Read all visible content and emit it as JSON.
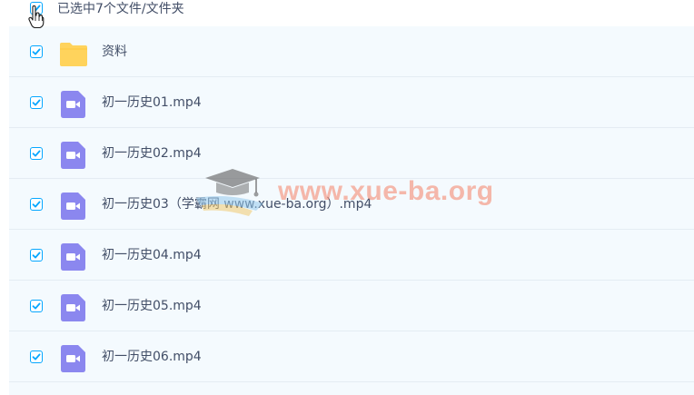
{
  "selection": {
    "summary": "已选中7个文件/文件夹",
    "all_checked": true
  },
  "rows": [
    {
      "name": "资料",
      "type": "folder",
      "checked": true
    },
    {
      "name": "初一历史01.mp4",
      "type": "video",
      "checked": true
    },
    {
      "name": "初一历史02.mp4",
      "type": "video",
      "checked": true
    },
    {
      "name": "初一历史03（学霸网 www.xue-ba.org）.mp4",
      "type": "video",
      "checked": true
    },
    {
      "name": "初一历史04.mp4",
      "type": "video",
      "checked": true
    },
    {
      "name": "初一历史05.mp4",
      "type": "video",
      "checked": true
    },
    {
      "name": "初一历史06.mp4",
      "type": "video",
      "checked": true
    }
  ],
  "watermark": {
    "text": "www.xue-ba.org"
  },
  "icons": {
    "checkbox": "checkbox-checked-icon",
    "folder": "folder-icon",
    "video": "video-file-icon",
    "cursor": "hand-pointer-icon",
    "watermark": "graduation-cap-logo"
  },
  "colors": {
    "checkbox_border": "#06a7ff",
    "checkmark": "#06a7ff",
    "list_background": "#f4fafe",
    "row_divider": "#e4ecf3",
    "folder": "#ffd35c",
    "video": "#8b87ef",
    "text": "#424e67",
    "watermark": "#f48e76"
  }
}
